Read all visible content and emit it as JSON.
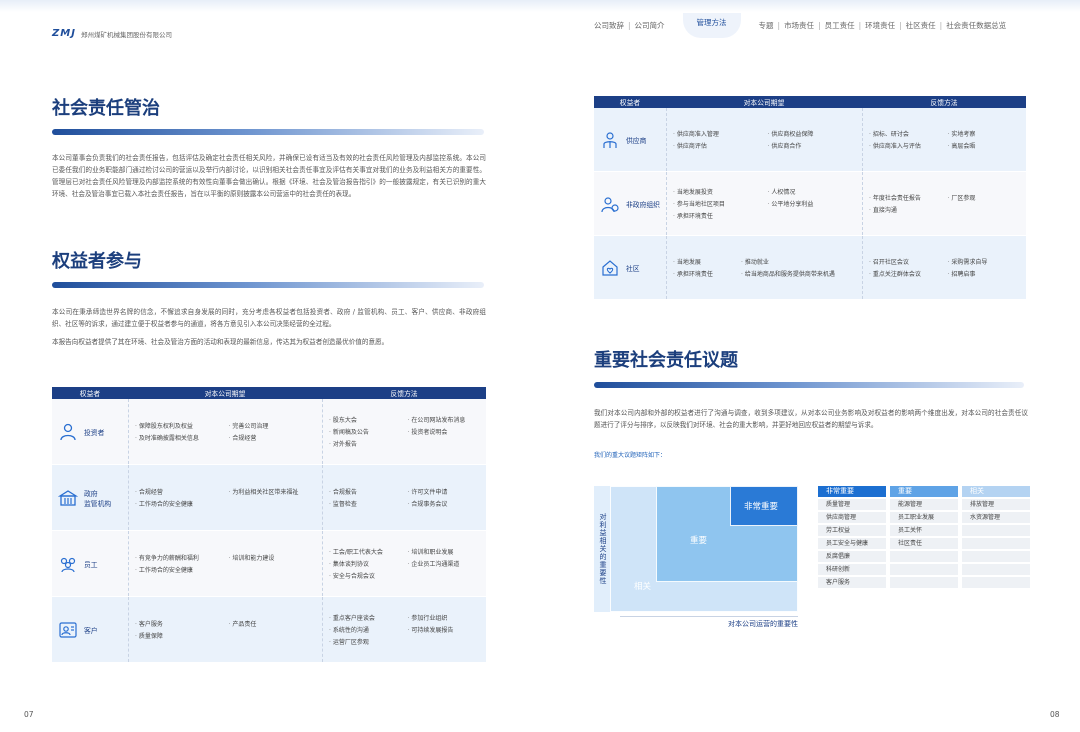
{
  "header": {
    "logo_mark": "ZMJ",
    "logo_text": "郑州煤矿机械集团股份有限公司",
    "nav": [
      "公司致辞",
      "公司简介",
      "管理方法",
      "专题",
      "市场责任",
      "员工责任",
      "环境责任",
      "社区责任",
      "社会责任数据总览"
    ],
    "active_nav": "管理方法"
  },
  "left": {
    "governance_title": "社会责任管治",
    "governance_text": "本公司董事会负责我们的社会责任报告，包括评估及确定社会责任相关风险，并确保已设有适当及有效的社会责任风险管理及内部监控系统。本公司已委任我们的业务职能部门通过检讨公司的营运以及举行内部讨论，以识别相关社会责任事宜及评估有关事宜对我们的业务及利益相关方的重要性。管理层已对社会责任风险管理及内部监控系统的有效性向董事会做出确认。根据《环境、社会及管治报告指引》的一般披露规定，有关已识别的重大环境、社会及管治事宜已载入本社会责任报告，旨在以平衡的原则披露本公司营运中的社会责任的表现。",
    "stakeholder_title": "权益者参与",
    "stakeholder_text1": "本公司在秉承缔造世界名牌的信念，不懈追求自身发展的同时，充分考虑各权益者包括投资者、政府 / 监管机构、员工、客户、供应商、非政府组织、社区等的诉求，通过建立便于权益者参与的通道，将各方意见引入本公司决策经营的全过程。",
    "stakeholder_text2": "本报告向权益者提供了其在环境、社会及管治方面的活动和表现的最新信息，传达其为权益者创造最优价值的意愿。",
    "table": {
      "headers": [
        "权益者",
        "对本公司期望",
        "反馈方法"
      ],
      "rows": [
        {
          "role": "投资者",
          "icon": "investor-icon",
          "expect": [
            "保障股东权利及权益",
            "完善公司治理",
            "及时准确披露相关信息",
            "合规经营"
          ],
          "feedback": [
            "股东大会",
            "在公司网站发布消息",
            "新闻稿及公告",
            "投资者说明会",
            "对外报告"
          ]
        },
        {
          "role": "政府\n监管机构",
          "icon": "government-icon",
          "expect": [
            "合规经营",
            "为利益相关社区带来福祉",
            "工作场合的安全健康"
          ],
          "feedback": [
            "合规报告",
            "许可文件申请",
            "监督检查",
            "合规事务会议"
          ]
        },
        {
          "role": "员工",
          "icon": "employee-icon",
          "expect": [
            "有竞争力的薪酬和福利",
            "培训和能力建设",
            "工作场合的安全健康"
          ],
          "feedback": [
            "工会/职工代表大会",
            "培训和职业发展",
            "集体谈判协议",
            "企业员工沟通渠道",
            "安全与合规会议"
          ]
        },
        {
          "role": "客户",
          "icon": "customer-icon",
          "expect": [
            "客户服务",
            "产品责任",
            "质量保障"
          ],
          "feedback": [
            "重点客户座谈会",
            "参加行业组织",
            "系统性的沟通",
            "可持续发展报告",
            "运营厂区参观"
          ]
        }
      ]
    },
    "page_number": "07"
  },
  "right": {
    "table": {
      "headers": [
        "权益者",
        "对本公司期望",
        "反馈方法"
      ],
      "rows": [
        {
          "role": "供应商",
          "icon": "supplier-icon",
          "expect": [
            "供应商准入管理",
            "供应商权益保障",
            "供应商评估",
            "供应商合作"
          ],
          "feedback": [
            "招标、研讨会",
            "实地考察",
            "供应商准入与评估",
            "高层会晤"
          ]
        },
        {
          "role": "非政府组织",
          "icon": "ngo-icon",
          "expect": [
            "当地发展投资",
            "人权情况",
            "参与当地社区项目",
            "公平地分享利益",
            "承担环境责任"
          ],
          "feedback": [
            "年度社会责任报告",
            "厂区参观",
            "直接沟通"
          ]
        },
        {
          "role": "社区",
          "icon": "community-icon",
          "expect": [
            "当地发展",
            "推动就业",
            "承担环境责任",
            "给当地商品和服务提供商带来机遇"
          ],
          "feedback": [
            "召开社区会议",
            "采购需求自导",
            "重点关注群体会议",
            "招聘启事"
          ]
        }
      ]
    },
    "issues_title": "重要社会责任议题",
    "issues_text": "我们对本公司内部和外部的权益者进行了沟通与调查，收到多项建议，从对本公司业务影响及对权益者的影响两个维度出发，对本公司的社会责任议题进行了评分与排序，以反映我们对环境、社会的重大影响，并更好地回应权益者的期望与诉求。",
    "matrix_caption": "我们的重大议题矩阵如下：",
    "matrix": {
      "y_axis": "对利益相关的重要性",
      "x_axis": "对本公司运营的重要性",
      "zones": {
        "related": "相关",
        "important": "重要",
        "very_important": "非常重要"
      }
    },
    "legend": [
      {
        "head": "非常重要",
        "color": "#1c6fd1",
        "items": [
          "质量管理",
          "供应商管理",
          "劳工权益",
          "员工安全与健康",
          "反腐倡廉",
          "科研创新",
          "客户服务"
        ]
      },
      {
        "head": "重要",
        "color": "#5fa3e6",
        "items": [
          "能源管理",
          "员工职业发展",
          "员工关怀",
          "社区责任",
          "",
          "",
          ""
        ]
      },
      {
        "head": "相关",
        "color": "#b4d3f2",
        "items": [
          "排放管理",
          "水资源管理",
          "",
          "",
          "",
          "",
          ""
        ]
      }
    ],
    "page_number": "08"
  }
}
